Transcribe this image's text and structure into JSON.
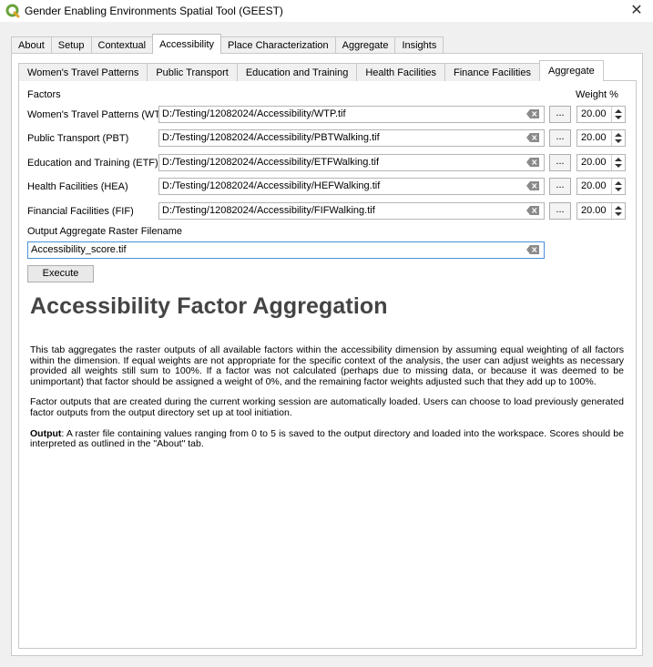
{
  "window": {
    "title": "Gender Enabling Environments Spatial Tool (GEEST)",
    "logo_icon": "qgis-logo-icon",
    "close_label": "✕"
  },
  "tabs": [
    {
      "label": "About"
    },
    {
      "label": "Setup"
    },
    {
      "label": "Contextual"
    },
    {
      "label": "Accessibility",
      "active": true
    },
    {
      "label": "Place Characterization"
    },
    {
      "label": "Aggregate"
    },
    {
      "label": "Insights"
    }
  ],
  "subtabs": [
    {
      "label": "Women's Travel Patterns"
    },
    {
      "label": "Public Transport"
    },
    {
      "label": "Education and Training"
    },
    {
      "label": "Health Facilities"
    },
    {
      "label": "Finance Facilities"
    },
    {
      "label": "Aggregate",
      "active": true
    }
  ],
  "form": {
    "factors_header": "Factors",
    "weight_header": "Weight %",
    "rows": [
      {
        "label": "Women's Travel Patterns (WTP)",
        "path": "D:/Testing/12082024/Accessibility/WTP.tif",
        "weight": "20.00"
      },
      {
        "label": "Public Transport (PBT)",
        "path": "D:/Testing/12082024/Accessibility/PBTWalking.tif",
        "weight": "20.00"
      },
      {
        "label": "Education and Training (ETF)",
        "path": "D:/Testing/12082024/Accessibility/ETFWalking.tif",
        "weight": "20.00"
      },
      {
        "label": "Health Facilities (HEA)",
        "path": "D:/Testing/12082024/Accessibility/HEFWalking.tif",
        "weight": "20.00"
      },
      {
        "label": "Financial Facilities (FIF)",
        "path": "D:/Testing/12082024/Accessibility/FIFWalking.tif",
        "weight": "20.00"
      }
    ],
    "browse_label": "...",
    "output_label": "Output Aggregate Raster Filename",
    "output_value": "Accessibility_score.tif",
    "execute_label": "Execute"
  },
  "doc": {
    "heading": "Accessibility Factor Aggregation",
    "para1": "This tab aggregates the raster outputs of all available factors within the accessibility dimension by assuming equal weighting of all factors within the dimension. If equal weights are not appropriate for the specific context of the analysis, the user can adjust weights as necessary provided all weights still sum to 100%. If a factor was not calculated (perhaps due to missing data, or because it was deemed to be unimportant) that factor should be assigned a weight of 0%, and the remaining factor weights adjusted such that they add up to 100%.",
    "para2": "Factor outputs that are created during the current working session are automatically loaded. Users can choose to load previously generated factor outputs from the output directory set up at tool initiation.",
    "para3_label": "Output",
    "para3": ": A raster file containing values ranging from 0 to 5 is saved to the output directory and loaded into the workspace. Scores should be interpreted as outlined in the \"About\" tab."
  },
  "colors": {
    "accent_focus": "#4a90d9",
    "heading": "#444444",
    "pane_bg": "#ffffff",
    "window_bg": "#f0f0f0"
  }
}
